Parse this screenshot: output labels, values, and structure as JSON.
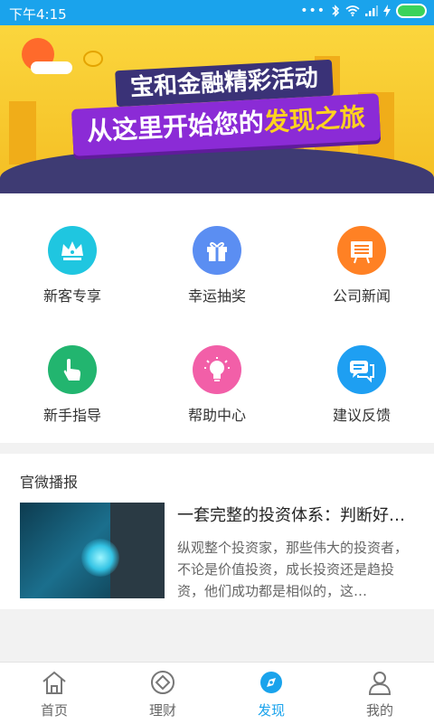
{
  "status_bar": {
    "time": "下午4:15"
  },
  "banner": {
    "line1": "宝和金融精彩活动",
    "line2_prefix": "从这里开始您的",
    "line2_highlight": "发现之旅"
  },
  "grid": {
    "items": [
      {
        "label": "新客专享",
        "icon": "crown-icon",
        "color": "#1fc6e0"
      },
      {
        "label": "幸运抽奖",
        "icon": "gift-icon",
        "color": "#5b8ef2"
      },
      {
        "label": "公司新闻",
        "icon": "newspaper-icon",
        "color": "#ff8124"
      },
      {
        "label": "新手指导",
        "icon": "hand-pointer-icon",
        "color": "#22b56f"
      },
      {
        "label": "帮助中心",
        "icon": "lightbulb-icon",
        "color": "#f25fa8"
      },
      {
        "label": "建议反馈",
        "icon": "chat-icon",
        "color": "#1e9ff2"
      }
    ]
  },
  "news": {
    "section_title": "官微播报",
    "headline": "一套完整的投资体系：判断好…",
    "summary": "纵观整个投资家，那些伟大的投资者，不论是价值投资，成长投资还是趋投资，他们成功都是相似的，这…"
  },
  "bottom_nav": {
    "items": [
      {
        "label": "首页",
        "icon": "home-icon"
      },
      {
        "label": "理财",
        "icon": "finance-icon"
      },
      {
        "label": "发现",
        "icon": "compass-icon",
        "active": true
      },
      {
        "label": "我的",
        "icon": "user-icon"
      }
    ],
    "active_color": "#1aa3ec"
  }
}
